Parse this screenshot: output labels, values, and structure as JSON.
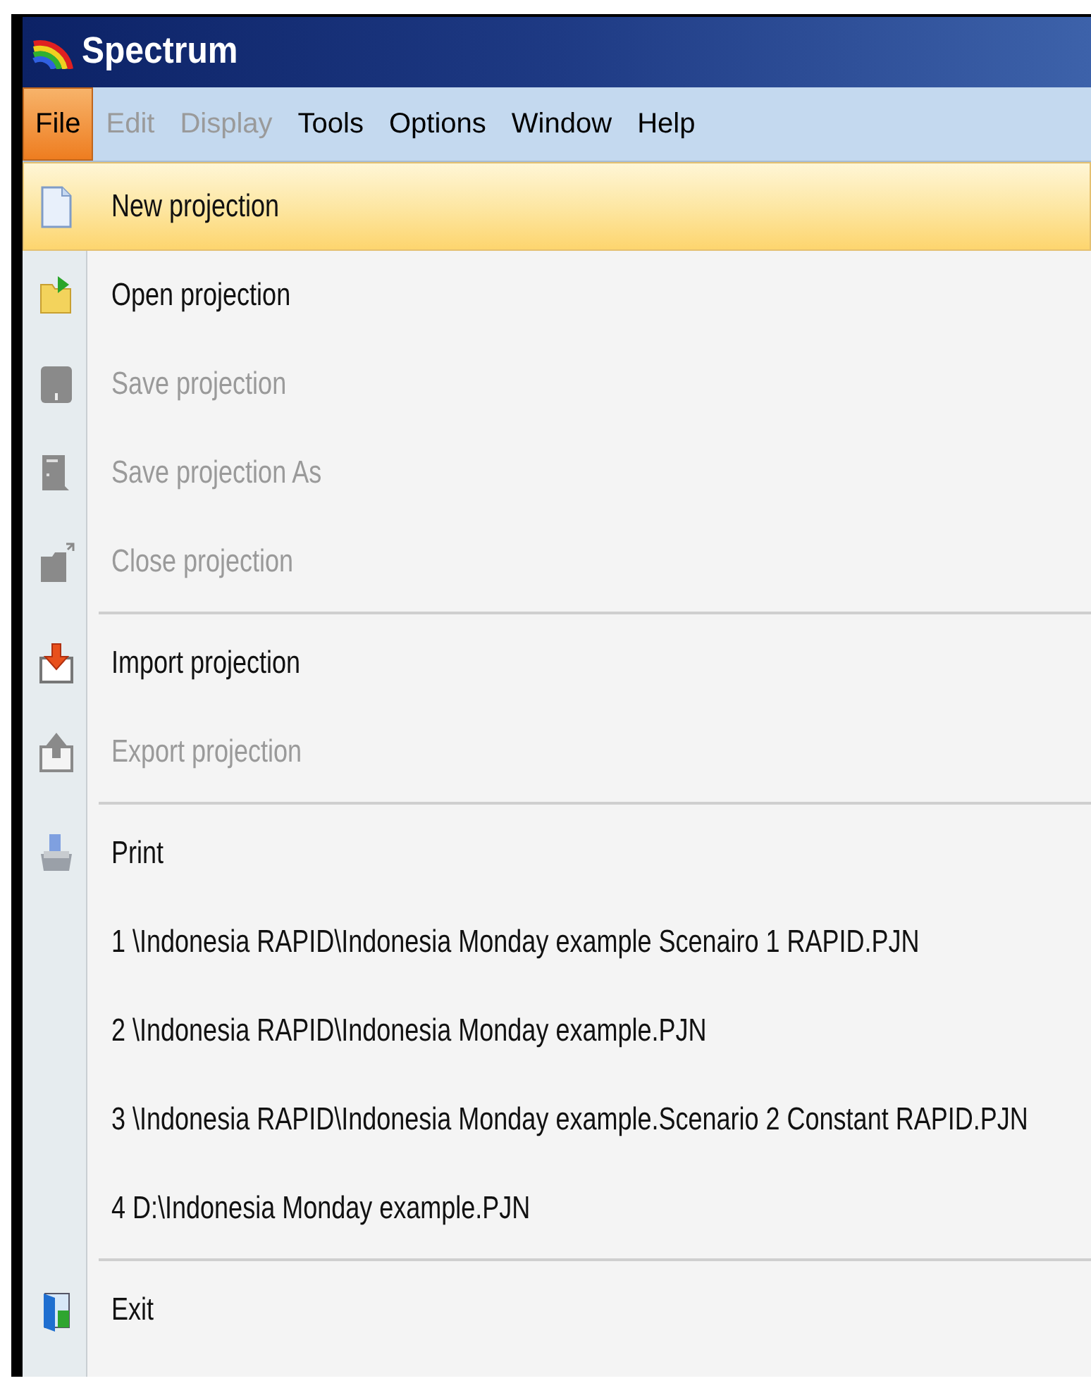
{
  "window": {
    "title": "Spectrum"
  },
  "menu_bar": [
    {
      "label": "File",
      "selected": true,
      "disabled": false
    },
    {
      "label": "Edit",
      "selected": false,
      "disabled": true
    },
    {
      "label": "Display",
      "selected": false,
      "disabled": true
    },
    {
      "label": "Tools",
      "selected": false,
      "disabled": false
    },
    {
      "label": "Options",
      "selected": false,
      "disabled": false
    },
    {
      "label": "Window",
      "selected": false,
      "disabled": false
    },
    {
      "label": "Help",
      "selected": false,
      "disabled": false
    }
  ],
  "file_menu": [
    {
      "kind": "item",
      "label": "New projection",
      "selected": true,
      "disabled": false
    },
    {
      "kind": "item",
      "label": "Open projection",
      "selected": false,
      "disabled": false
    },
    {
      "kind": "item",
      "label": "Save projection",
      "selected": false,
      "disabled": true
    },
    {
      "kind": "item",
      "label": "Save projection As",
      "selected": false,
      "disabled": true
    },
    {
      "kind": "item",
      "label": "Close projection",
      "selected": false,
      "disabled": true
    },
    {
      "kind": "separator"
    },
    {
      "kind": "item",
      "label": "Import projection",
      "selected": false,
      "disabled": false
    },
    {
      "kind": "item",
      "label": "Export projection",
      "selected": false,
      "disabled": true
    },
    {
      "kind": "separator"
    },
    {
      "kind": "item",
      "label": "Print",
      "selected": false,
      "disabled": false
    },
    {
      "kind": "item",
      "label": "1 \\Indonesia RAPID\\Indonesia Monday example Scenairo 1 RAPID.PJN",
      "selected": false,
      "disabled": false
    },
    {
      "kind": "item",
      "label": "2 \\Indonesia RAPID\\Indonesia Monday example.PJN",
      "selected": false,
      "disabled": false
    },
    {
      "kind": "item",
      "label": "3 \\Indonesia RAPID\\Indonesia Monday example.Scenario 2 Constant RAPID.PJN",
      "selected": false,
      "disabled": false
    },
    {
      "kind": "item",
      "label": "4 D:\\Indonesia Monday example.PJN",
      "selected": false,
      "disabled": false
    },
    {
      "kind": "separator"
    },
    {
      "kind": "item",
      "label": "Exit",
      "selected": false,
      "disabled": false
    }
  ]
}
